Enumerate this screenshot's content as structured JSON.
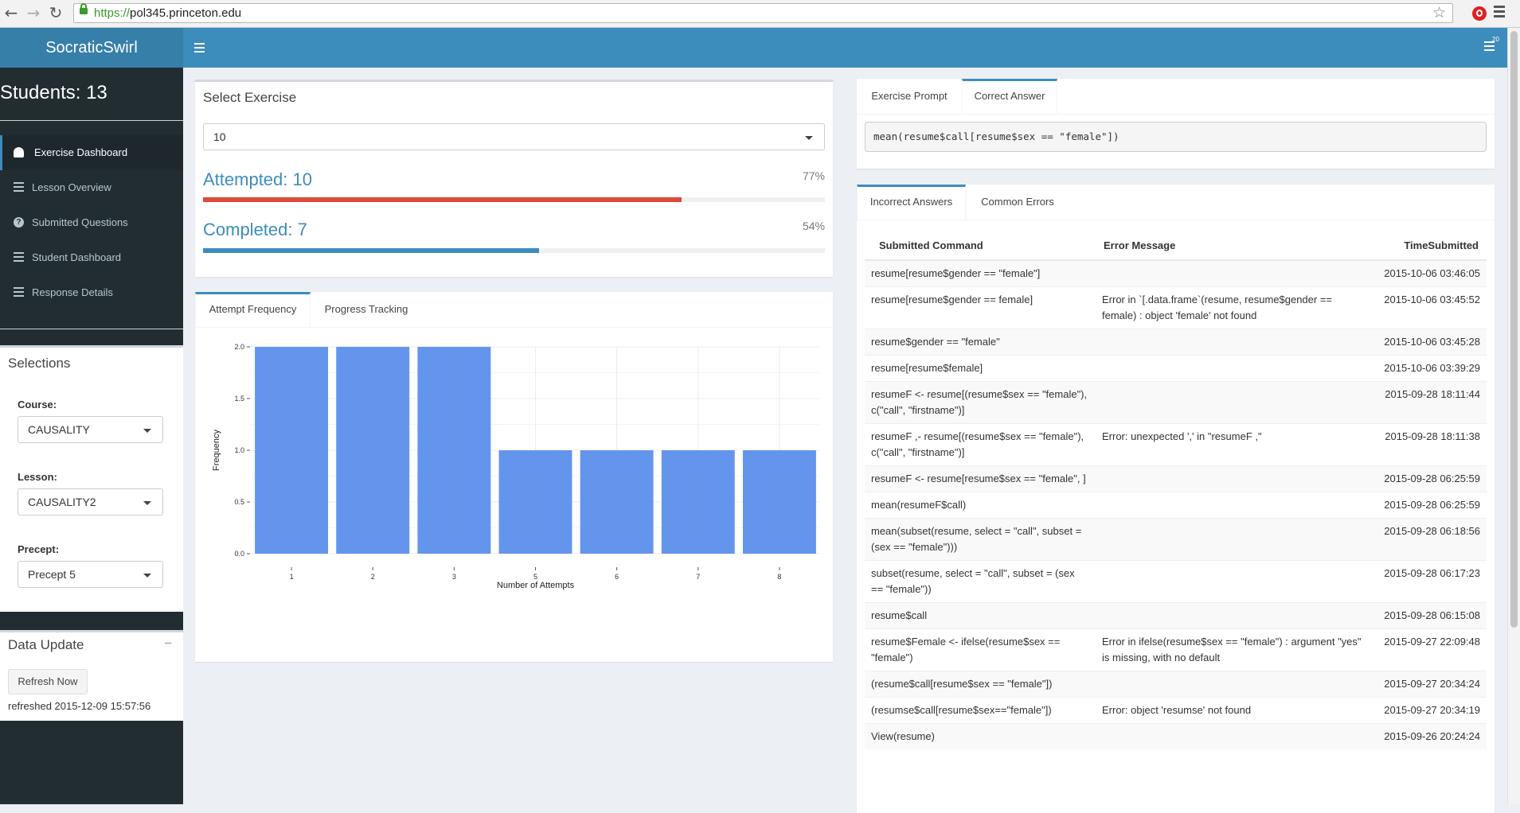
{
  "browser": {
    "url_scheme": "https://",
    "url_host": "pol345.princeton.edu"
  },
  "app": {
    "logo": "SocraticSwirl",
    "notif_count": "20"
  },
  "sidebar": {
    "students": "Students: 13",
    "menu": [
      {
        "label": "Exercise Dashboard",
        "icon": "dashboard-icon"
      },
      {
        "label": "Lesson Overview",
        "icon": "list-icon"
      },
      {
        "label": "Submitted Questions",
        "icon": "question-circle-icon"
      },
      {
        "label": "Student Dashboard",
        "icon": "list-icon"
      },
      {
        "label": "Response Details",
        "icon": "list-icon"
      }
    ],
    "selections": {
      "title": "Selections",
      "course_label": "Course:",
      "course_value": "CAUSALITY",
      "lesson_label": "Lesson:",
      "lesson_value": "CAUSALITY2",
      "precept_label": "Precept:",
      "precept_value": "Precept 5"
    },
    "data_update": {
      "title": "Data Update",
      "collapse": "−",
      "refresh_button": "Refresh Now",
      "refreshed": "refreshed 2015-12-09 15:57:56"
    }
  },
  "exercise": {
    "title": "Select Exercise",
    "selected": "10",
    "attempted_label": "Attempted: 10",
    "attempted_pct": "77%",
    "attempted_fraction": 0.77,
    "completed_label": "Completed: 7",
    "completed_pct": "54%",
    "completed_fraction": 0.54,
    "colors": {
      "attempted": "#dd4b39",
      "completed": "#3c8dbc"
    }
  },
  "chart_panel": {
    "tabs": [
      "Attempt Frequency",
      "Progress Tracking"
    ]
  },
  "chart_data": {
    "type": "bar",
    "categories": [
      "1",
      "2",
      "3",
      "5",
      "6",
      "7",
      "8"
    ],
    "values": [
      2,
      2,
      2,
      1,
      1,
      1,
      1
    ],
    "xlabel": "Number of Attempts",
    "ylabel": "Frequency",
    "ylim": [
      0,
      2
    ],
    "yticks": [
      "0.0",
      "0.5",
      "1.0",
      "1.5",
      "2.0"
    ],
    "ytick_values": [
      0,
      0.5,
      1,
      1.5,
      2
    ],
    "bar_color": "#6495ed",
    "grid": true
  },
  "answer_panel": {
    "tabs": [
      "Exercise Prompt",
      "Correct Answer"
    ],
    "correct_answer": "mean(resume$call[resume$sex == \"female\"])"
  },
  "errors_panel": {
    "tabs": [
      "Incorrect Answers",
      "Common Errors"
    ],
    "columns": [
      "Submitted Command",
      "Error Message",
      "TimeSubmitted"
    ],
    "rows": [
      {
        "cmd": "resume[resume$gender == \"female\"]",
        "err": "",
        "time": "2015-10-06 03:46:05"
      },
      {
        "cmd": "resume[resume$gender == female]",
        "err": "Error in `[.data.frame`(resume, resume$gender == female) : object 'female' not found",
        "time": "2015-10-06 03:45:52"
      },
      {
        "cmd": "resume$gender == \"female\"",
        "err": "",
        "time": "2015-10-06 03:45:28"
      },
      {
        "cmd": "resume[resume$female]",
        "err": "",
        "time": "2015-10-06 03:39:29"
      },
      {
        "cmd": "resumeF <- resume[(resume$sex == \"female\"), c(\"call\", \"firstname\")]",
        "err": "",
        "time": "2015-09-28 18:11:44"
      },
      {
        "cmd": "resumeF ,- resume[(resume$sex == \"female\"), c(\"call\", \"firstname\")]",
        "err": "Error: unexpected ',' in \"resumeF ,\"",
        "time": "2015-09-28 18:11:38"
      },
      {
        "cmd": "resumeF <- resume[resume$sex == \"female\", ]",
        "err": "",
        "time": "2015-09-28 06:25:59"
      },
      {
        "cmd": "mean(resumeF$call)",
        "err": "",
        "time": "2015-09-28 06:25:59"
      },
      {
        "cmd": "mean(subset(resume, select = \"call\", subset = (sex == \"female\")))",
        "err": "",
        "time": "2015-09-28 06:18:56"
      },
      {
        "cmd": "subset(resume, select = \"call\", subset = (sex == \"female\"))",
        "err": "",
        "time": "2015-09-28 06:17:23"
      },
      {
        "cmd": "resume$call",
        "err": "",
        "time": "2015-09-28 06:15:08"
      },
      {
        "cmd": "resume$Female <- ifelse(resume$sex == \"female\")",
        "err": "Error in ifelse(resume$sex == \"female\") : argument \"yes\" is missing, with no default",
        "time": "2015-09-27 22:09:48"
      },
      {
        "cmd": "(resume$call[resume$sex == \"female\"])",
        "err": "",
        "time": "2015-09-27 20:34:24"
      },
      {
        "cmd": "(resumse$call[resume$sex==\"female\"])",
        "err": "Error: object 'resumse' not found",
        "time": "2015-09-27 20:34:19"
      },
      {
        "cmd": "View(resume)",
        "err": "",
        "time": "2015-09-26 20:24:24"
      }
    ]
  }
}
